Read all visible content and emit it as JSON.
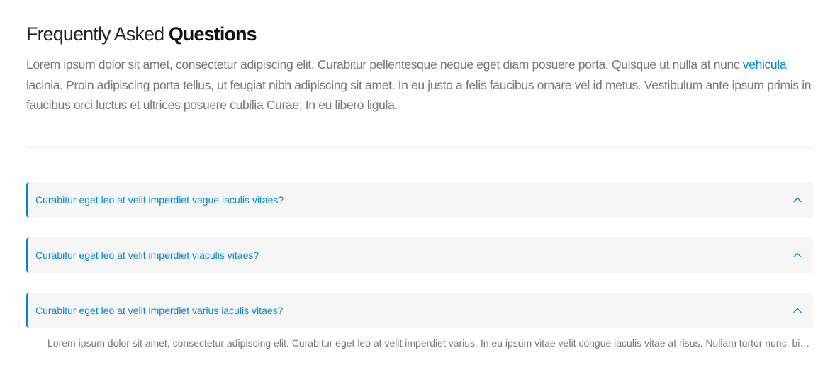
{
  "header": {
    "title_prefix": "Frequently Asked ",
    "title_emphasis": "Questions"
  },
  "intro": {
    "text_before_link": "Lorem ipsum dolor sit amet, consectetur adipiscing elit. Curabitur pellentesque neque eget diam posuere porta. Quisque ut nulla at nunc ",
    "link_text": "vehicula",
    "text_after_link": " lacinia. Proin adipiscing porta tellus, ut feugiat nibh adipiscing sit amet. In eu justo a felis faucibus ornare vel id metus. Vestibulum ante ipsum primis in faucibus orci luctus et ultrices posuere cubilia Curae; In eu libero ligula."
  },
  "faq": {
    "items": [
      {
        "question": "Curabitur eget leo at velit imperdiet vague iaculis vitaes?",
        "icon": "chevron-up-icon"
      },
      {
        "question": "Curabitur eget leo at velit imperdiet viaculis vitaes?",
        "icon": "chevron-up-icon"
      },
      {
        "question": "Curabitur eget leo at velit imperdiet varius iaculis vitaes?",
        "icon": "chevron-up-icon"
      }
    ],
    "answer": "Lorem ipsum dolor sit amet, consectetur adipiscing elit. Curabitur eget leo at velit imperdiet varius. In eu ipsum vitae velit congue iaculis vitae at risus. Nullam tortor nunc, bibendum vitae semper a, volutpat eget massa."
  },
  "colors": {
    "accent": "#0088cc",
    "heading": "#222222",
    "body_text": "#777777",
    "panel_bg": "#f6f6f6",
    "divider": "#eeeeee"
  }
}
